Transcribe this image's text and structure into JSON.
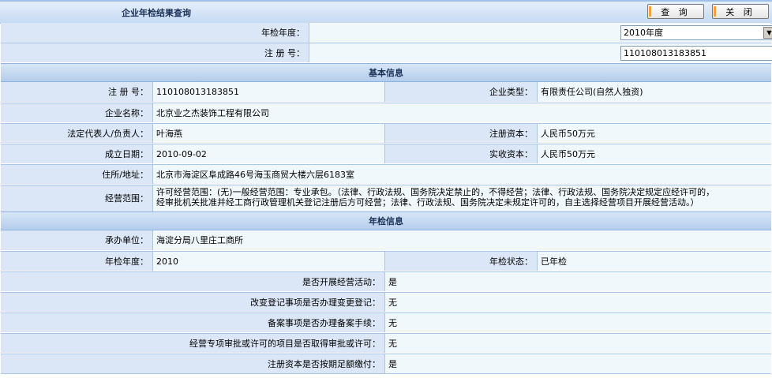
{
  "header": {
    "title": "企业年检结果查询",
    "query_label": "查 询",
    "close_label": "关 闭"
  },
  "search": {
    "year_label": "年检年度：",
    "year_value": "2010年度",
    "regno_label": "注 册 号：",
    "regno_value": "110108013183851",
    "required_mark": "*"
  },
  "basic": {
    "section_title": "基本信息",
    "regno_label": "注 册 号：",
    "regno_value": "110108013183851",
    "type_label": "企业类型：",
    "type_value": "有限责任公司(自然人独资)",
    "name_label": "企业名称：",
    "name_value": "北京业之杰装饰工程有限公司",
    "rep_label": "法定代表人/负责人：",
    "rep_value": "叶海燕",
    "capital_label": "注册资本：",
    "capital_value": "人民币50万元",
    "date_label": "成立日期：",
    "date_value": "2010-09-02",
    "paid_label": "实收资本：",
    "paid_value": "人民币50万元",
    "addr_label": "住所/地址：",
    "addr_value": "北京市海淀区阜成路46号海玉商贸大楼六层6183室",
    "scope_label": "经营范围：",
    "scope_line1": "许可经营范围：(无)一般经营范围：专业承包。（法律、行政法规、国务院决定禁止的，不得经营；法律、行政法规、国务院决定规定应经许可的，",
    "scope_line2": "经审批机关批准并经工商行政管理机关登记注册后方可经营；法律、行政法规、国务院决定未规定许可的，自主选择经营项目开展经营活动。）"
  },
  "annual": {
    "section_title": "年检信息",
    "org_label": "承办单位：",
    "org_value": "海淀分局八里庄工商所",
    "year_label": "年检年度：",
    "year_value": "2010",
    "status_label": "年检状态：",
    "status_value": "已年检",
    "q1_label": "是否开展经营活动：",
    "q1_value": "是",
    "q2_label": "改变登记事项是否办理变更登记：",
    "q2_value": "无",
    "q3_label": "备案事项是否办理备案手续：",
    "q3_value": "无",
    "q4_label": "经营专项审批或许可的项目是否取得审批或许可：",
    "q4_value": "无",
    "q5_label": "注册资本是否按期足额缴付：",
    "q5_value": "是"
  }
}
